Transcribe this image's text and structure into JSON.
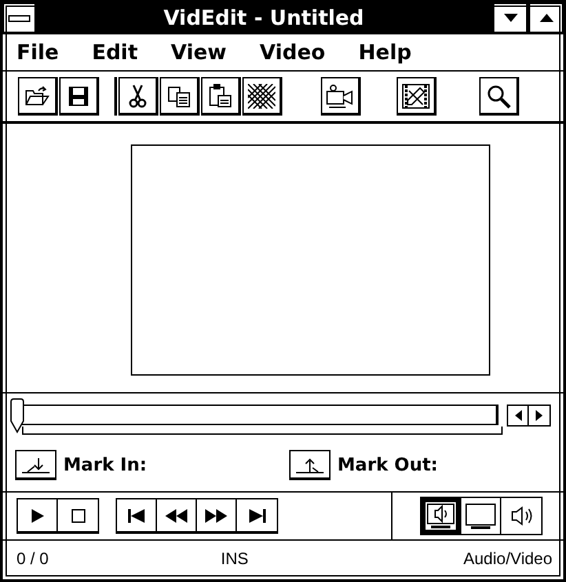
{
  "window": {
    "title": "VidEdit - Untitled"
  },
  "menu": [
    "File",
    "Edit",
    "View",
    "Video",
    "Help"
  ],
  "scrubber": {
    "level": 0
  },
  "marks": [
    {
      "label": "Mark In:",
      "kind": "in"
    },
    {
      "label": "Mark Out:",
      "kind": "out"
    }
  ],
  "view_buttons": [
    {
      "kind": "audio-video",
      "selected": true
    },
    {
      "kind": "video",
      "selected": false
    },
    {
      "kind": "audio",
      "selected": false
    }
  ],
  "status_bar": {
    "position": "0 / 0",
    "mode": "INS",
    "track": "Audio/Video"
  }
}
